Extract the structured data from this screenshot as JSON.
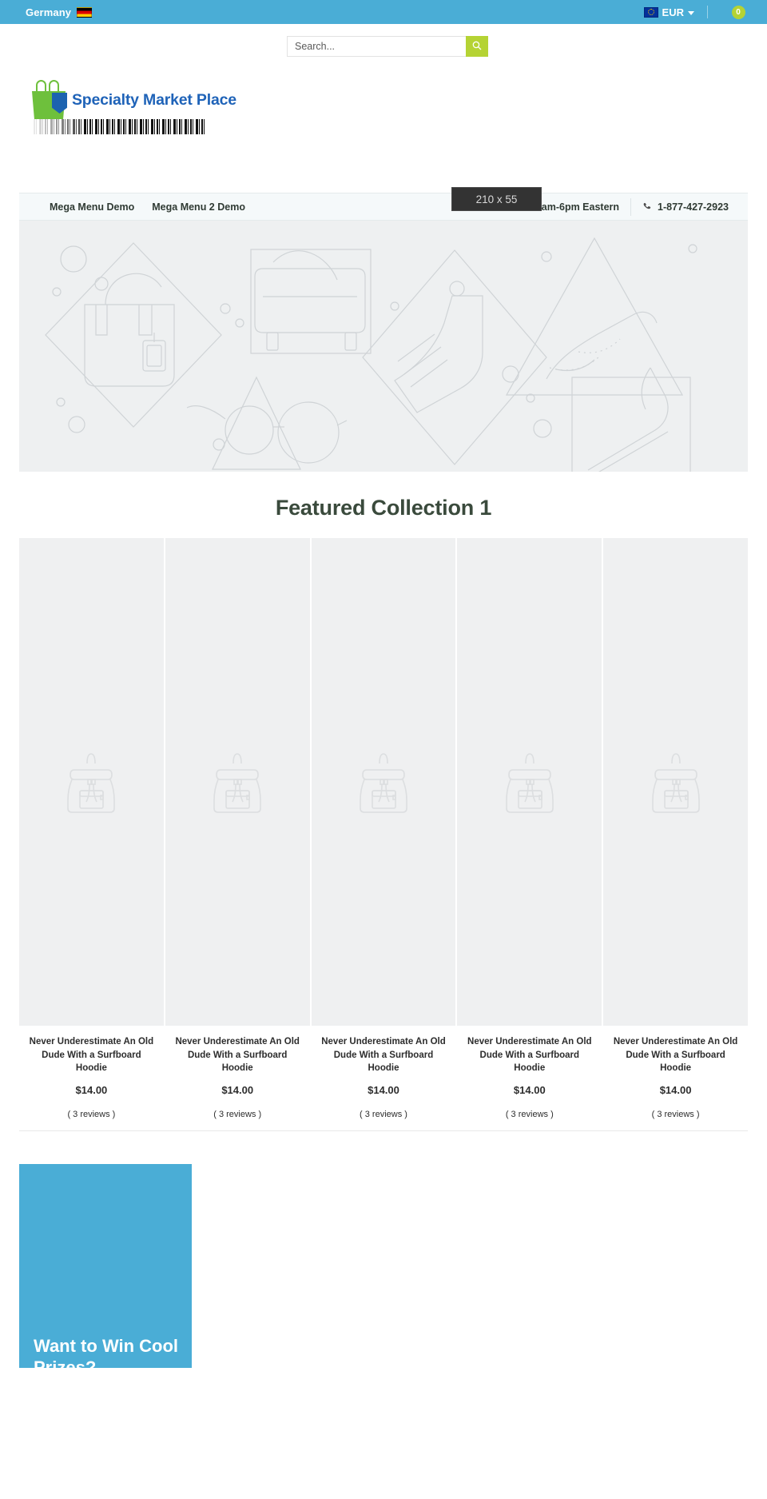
{
  "topbar": {
    "country": "Germany",
    "country_flag_icon": "flag-germany-icon",
    "currency": "EUR",
    "currency_flag_icon": "flag-eu-icon",
    "chevron_icon": "chevron-down-icon",
    "cart_icon": "cart-icon",
    "cart_count": "0",
    "accent_blue": "#4aadd6",
    "accent_green": "#b5d334"
  },
  "search": {
    "placeholder": "Search...",
    "value": "",
    "button_icon": "search-icon",
    "button_label": ""
  },
  "header": {
    "logo_text": "Specialty Market Place",
    "logo_icon": "shopping-bag-icon",
    "barcode_icon": "barcode-icon",
    "banner_placeholder": "210 x 55"
  },
  "nav": {
    "links": [
      {
        "label": "Mega Menu Demo"
      },
      {
        "label": "Mega Menu 2 Demo"
      }
    ],
    "hours": "Mon-Sat 9am-6pm Eastern",
    "phone_icon": "phone-icon",
    "phone": "1-877-427-2923"
  },
  "hero": {
    "alt": "fashion accessories line art banner"
  },
  "featured": {
    "title": "Featured Collection 1",
    "products": [
      {
        "title": "Never Underestimate An Old Dude With a Surfboard Hoodie",
        "price": "$14.00",
        "reviews": "( 3 reviews )",
        "image_icon": "backpack-placeholder-icon"
      },
      {
        "title": "Never Underestimate An Old Dude With a Surfboard Hoodie",
        "price": "$14.00",
        "reviews": "( 3 reviews )",
        "image_icon": "backpack-placeholder-icon"
      },
      {
        "title": "Never Underestimate An Old Dude With a Surfboard Hoodie",
        "price": "$14.00",
        "reviews": "( 3 reviews )",
        "image_icon": "backpack-placeholder-icon"
      },
      {
        "title": "Never Underestimate An Old Dude With a Surfboard Hoodie",
        "price": "$14.00",
        "reviews": "( 3 reviews )",
        "image_icon": "backpack-placeholder-icon"
      },
      {
        "title": "Never Underestimate An Old Dude With a Surfboard Hoodie",
        "price": "$14.00",
        "reviews": "( 3 reviews )",
        "image_icon": "backpack-placeholder-icon"
      }
    ]
  },
  "promo": {
    "heading": "Want to Win Cool Prizes?",
    "background": "#4aadd6"
  }
}
